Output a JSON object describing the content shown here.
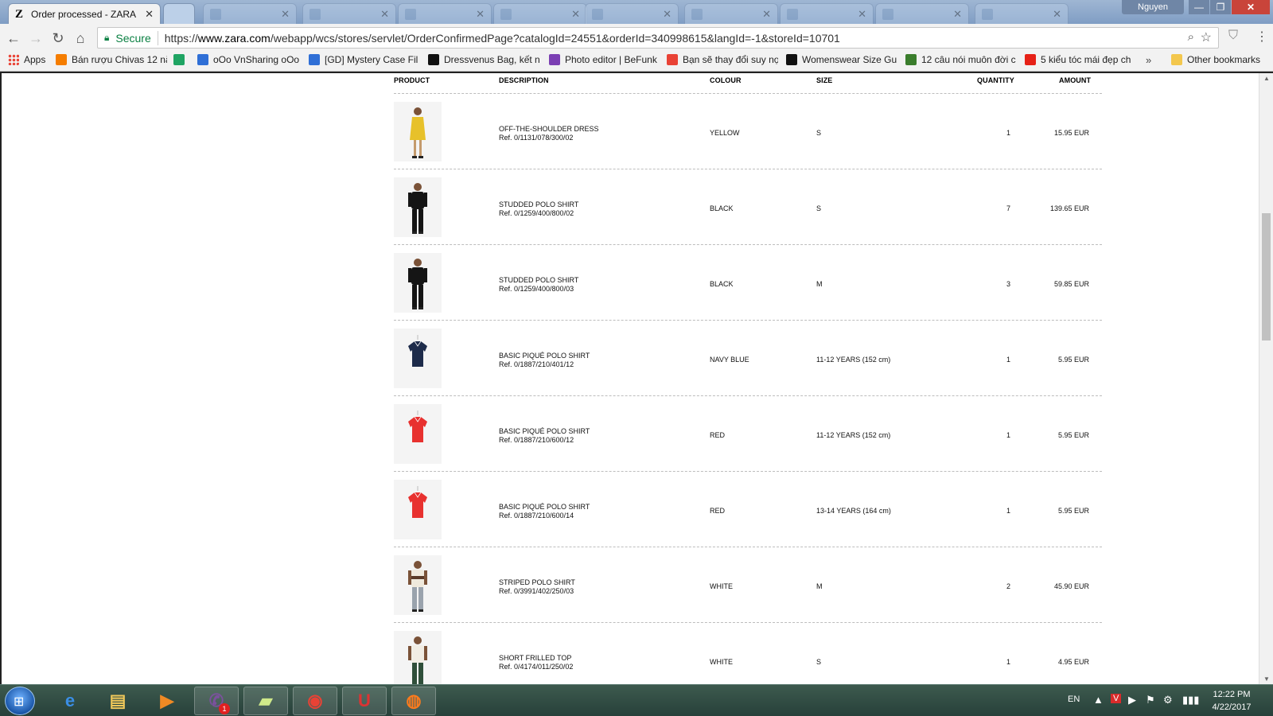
{
  "browser": {
    "tabs": [
      {
        "title": "Order processed - ZARA",
        "icon": "zara-icon",
        "active": true
      },
      {
        "title": "",
        "icon": "blank-tab-icon",
        "active": false
      }
    ],
    "profile_name": "Nguyen",
    "window_buttons": {
      "minimize": "—",
      "maximize": "❐",
      "close": "✕"
    },
    "secure_label": "Secure",
    "url_scheme": "https://",
    "url_host": "www.zara.com",
    "url_path": "/webapp/wcs/stores/servlet/OrderConfirmedPage?catalogId=24551&orderId=340998615&langId=-1&storeId=10701",
    "bookmarks": [
      {
        "label": "Apps",
        "icon": "apps-grid-icon",
        "color": "#e94235"
      },
      {
        "label": "Bán rượu Chivas 12 nă",
        "icon": "blogger-icon",
        "color": "#f57d00"
      },
      {
        "label": "",
        "icon": "google-drive-icon",
        "color": "#1fa463"
      },
      {
        "label": "oOo VnSharing oOo",
        "icon": "vnsharing-icon",
        "color": "#2f6fd6"
      },
      {
        "label": "[GD] Mystery Case Fil",
        "icon": "gd-icon",
        "color": "#2f6fd6"
      },
      {
        "label": "Dressvenus Bag, kết n",
        "icon": "lb-icon",
        "color": "#111111"
      },
      {
        "label": "Photo editor | BeFunk",
        "icon": "befunky-icon",
        "color": "#7b3fb3"
      },
      {
        "label": "Bạn sẽ thay đổi suy nọ",
        "icon": "chrome-icon",
        "color": "#e94235"
      },
      {
        "label": "Womenswear Size Gu",
        "icon": "circle-logo-icon",
        "color": "#111111"
      },
      {
        "label": "12 câu nói muôn đời c",
        "icon": "image-icon",
        "color": "#3a7d2c"
      },
      {
        "label": "5 kiểu tóc mái đẹp ch",
        "icon": "youtube-icon",
        "color": "#e62117"
      },
      {
        "label": "Other bookmarks",
        "icon": "folder-icon",
        "color": "#f3c74d"
      }
    ],
    "bookmarks_overflow": "»"
  },
  "order": {
    "headers": {
      "product": "PRODUCT",
      "description": "DESCRIPTION",
      "colour": "COLOUR",
      "size": "SIZE",
      "quantity": "QUANTITY",
      "amount": "AMOUNT"
    },
    "items": [
      {
        "name": "OFF-THE-SHOULDER DRESS",
        "ref": "Ref. 0/1131/078/300/02",
        "colour": "YELLOW",
        "size": "S",
        "quantity": "1",
        "amount": "15.95 EUR",
        "image": "model-yellow-dress"
      },
      {
        "name": "STUDDED POLO SHIRT",
        "ref": "Ref. 0/1259/400/800/02",
        "colour": "BLACK",
        "size": "S",
        "quantity": "7",
        "amount": "139.65 EUR",
        "image": "model-black-polo"
      },
      {
        "name": "STUDDED POLO SHIRT",
        "ref": "Ref. 0/1259/400/800/03",
        "colour": "BLACK",
        "size": "M",
        "quantity": "3",
        "amount": "59.85 EUR",
        "image": "model-black-polo"
      },
      {
        "name": "BASIC PIQUÉ POLO SHIRT",
        "ref": "Ref. 0/1887/210/401/12",
        "colour": "NAVY BLUE",
        "size": "11-12 YEARS (152 cm)",
        "quantity": "1",
        "amount": "5.95 EUR",
        "image": "navy-polo"
      },
      {
        "name": "BASIC PIQUÉ POLO SHIRT",
        "ref": "Ref. 0/1887/210/600/12",
        "colour": "RED",
        "size": "11-12 YEARS (152 cm)",
        "quantity": "1",
        "amount": "5.95 EUR",
        "image": "red-polo"
      },
      {
        "name": "BASIC PIQUÉ POLO SHIRT",
        "ref": "Ref. 0/1887/210/600/14",
        "colour": "RED",
        "size": "13-14 YEARS (164 cm)",
        "quantity": "1",
        "amount": "5.95 EUR",
        "image": "red-polo"
      },
      {
        "name": "STRIPED POLO SHIRT",
        "ref": "Ref. 0/3991/402/250/03",
        "colour": "WHITE",
        "size": "M",
        "quantity": "2",
        "amount": "45.90 EUR",
        "image": "model-striped-polo"
      },
      {
        "name": "SHORT FRILLED TOP",
        "ref": "Ref. 0/4174/011/250/02",
        "colour": "WHITE",
        "size": "S",
        "quantity": "1",
        "amount": "4.95 EUR",
        "image": "model-frilled-top"
      }
    ]
  },
  "taskbar": {
    "apps": [
      {
        "name": "internet-explorer",
        "icon": "e",
        "color": "#3a8ee6",
        "running": false
      },
      {
        "name": "file-explorer",
        "icon": "▤",
        "color": "#f0c85a",
        "running": false
      },
      {
        "name": "media-player",
        "icon": "▶",
        "color": "#f08a24",
        "running": false
      },
      {
        "name": "viber",
        "icon": "✆",
        "color": "#7b519d",
        "running": true
      },
      {
        "name": "sticky-notes",
        "icon": "▰",
        "color": "#cfe98a",
        "running": true
      },
      {
        "name": "chrome",
        "icon": "◉",
        "color": "#e94235",
        "running": true
      },
      {
        "name": "unikey",
        "icon": "U",
        "color": "#d33",
        "running": true
      },
      {
        "name": "firefox",
        "icon": "◍",
        "color": "#ff7b1c",
        "running": true
      }
    ],
    "viber_badge": "1",
    "language": "EN",
    "tray_icons": [
      "▲",
      "V",
      "▶",
      "⚑",
      "⚙",
      "▮▮▮"
    ],
    "time": "12:22 PM",
    "date": "4/22/2017"
  }
}
